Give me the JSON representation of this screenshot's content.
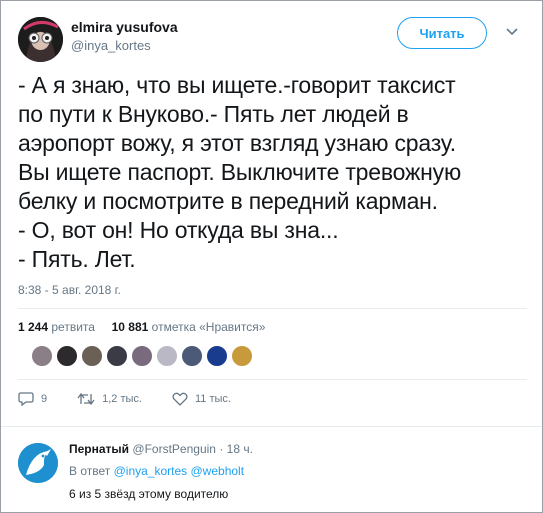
{
  "tweet": {
    "author_name": "elmira yusufova",
    "author_handle": "@inya_kortes",
    "follow_label": "Читать",
    "text_lines": [
      "- А я знаю, что вы ищете.-говорит таксист",
      "по пути к Внуково.- Пять лет людей в",
      "аэропорт вожу, я этот взгляд узнаю сразу.",
      "Вы ищете паспорт. Выключите тревожную",
      "белку и посмотрите в передний карман.",
      "- О, вот он! Но откуда вы зна...",
      "- Пять. Лет."
    ],
    "timestamp": "8:38 - 5 авг. 2018 г.",
    "retweet_count": "1 244",
    "retweet_label": "ретвита",
    "like_count": "10 881",
    "like_label": "отметка «Нравится»",
    "actions": {
      "reply_count": "9",
      "retweet_count": "1,2 тыс.",
      "like_count": "11 тыс."
    }
  },
  "likers": [
    {
      "color": "#8a7f86"
    },
    {
      "color": "#2d2a2e"
    },
    {
      "color": "#6b6056"
    },
    {
      "color": "#3a3b45"
    },
    {
      "color": "#7a6a7e"
    },
    {
      "color": "#b9b8c4"
    },
    {
      "color": "#4c5a78"
    },
    {
      "color": "#1a3c8f"
    },
    {
      "color": "#c99a3b"
    }
  ],
  "reply": {
    "author_name": "Пернатый",
    "author_handle": "@ForstPenguin",
    "time": "· 18 ч.",
    "in_reply_prefix": "В ответ",
    "mention1": "@inya_kortes",
    "mention2": "@webholt",
    "text": "6 из 5 звёзд этому водителю"
  },
  "colors": {
    "accent": "#1da1f2",
    "muted": "#657786",
    "text": "#14171a"
  }
}
